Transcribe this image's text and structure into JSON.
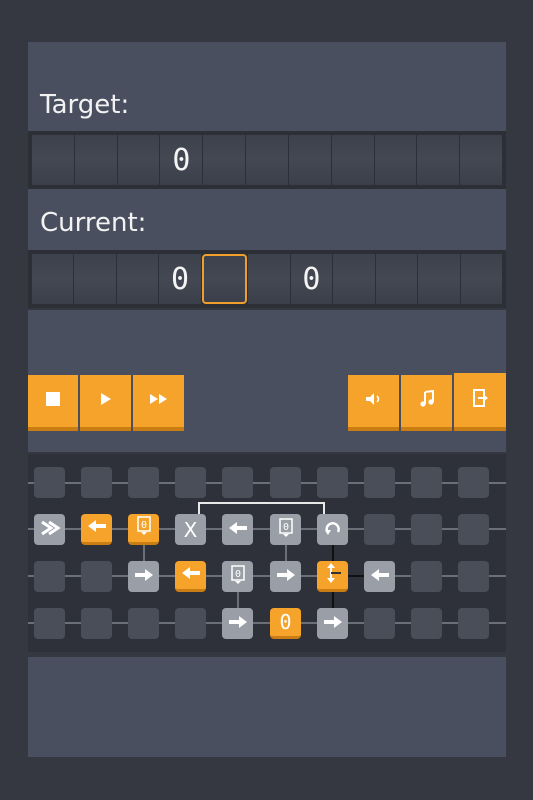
{
  "target": {
    "label": "Target:",
    "cells": [
      "",
      "",
      "",
      "0",
      "",
      "",
      "",
      "",
      "",
      "",
      ""
    ]
  },
  "current": {
    "label": "Current:",
    "cells": [
      "",
      "",
      "",
      "0",
      "",
      "",
      "0",
      "",
      "",
      "",
      ""
    ],
    "head_index": 4
  },
  "controls": {
    "stop": "stop-icon",
    "play": "play-icon",
    "fast_forward": "fast-forward-icon",
    "sound": "speaker-icon",
    "music": "music-note-icon",
    "exit": "exit-icon"
  },
  "board": {
    "literal_zero": "0",
    "cell_value_glyph": "0",
    "x_label": "X"
  },
  "colors": {
    "accent": "#f5a32b",
    "panel": "#4a4f5f",
    "background": "#353841"
  }
}
